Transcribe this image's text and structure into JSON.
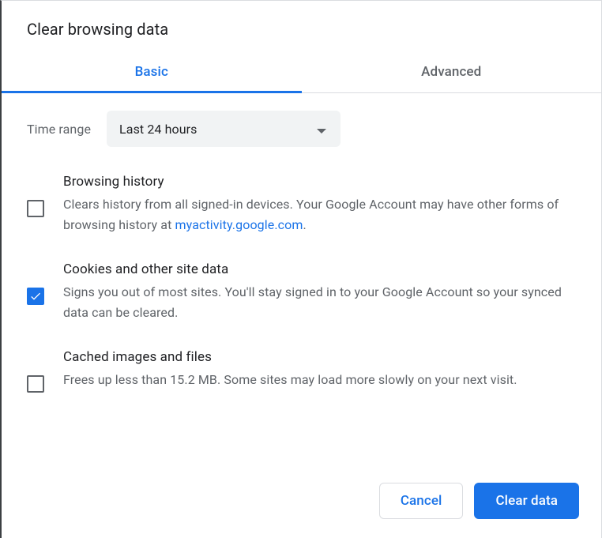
{
  "dialog": {
    "title": "Clear browsing data",
    "tabs": {
      "basic": "Basic",
      "advanced": "Advanced",
      "active": "basic"
    }
  },
  "time_range": {
    "label": "Time range",
    "selected": "Last 24 hours"
  },
  "options": [
    {
      "checked": false,
      "title": "Browsing history",
      "desc_pre": "Clears history from all signed-in devices. Your Google Account may have other forms of browsing history at ",
      "link_text": "myactivity.google.com",
      "desc_post": "."
    },
    {
      "checked": true,
      "title": "Cookies and other site data",
      "desc_pre": "Signs you out of most sites. You'll stay signed in to your Google Account so your synced data can be cleared.",
      "link_text": "",
      "desc_post": ""
    },
    {
      "checked": false,
      "title": "Cached images and files",
      "desc_pre": "Frees up less than 15.2 MB. Some sites may load more slowly on your next visit.",
      "link_text": "",
      "desc_post": ""
    }
  ],
  "footer": {
    "cancel": "Cancel",
    "confirm": "Clear data"
  }
}
